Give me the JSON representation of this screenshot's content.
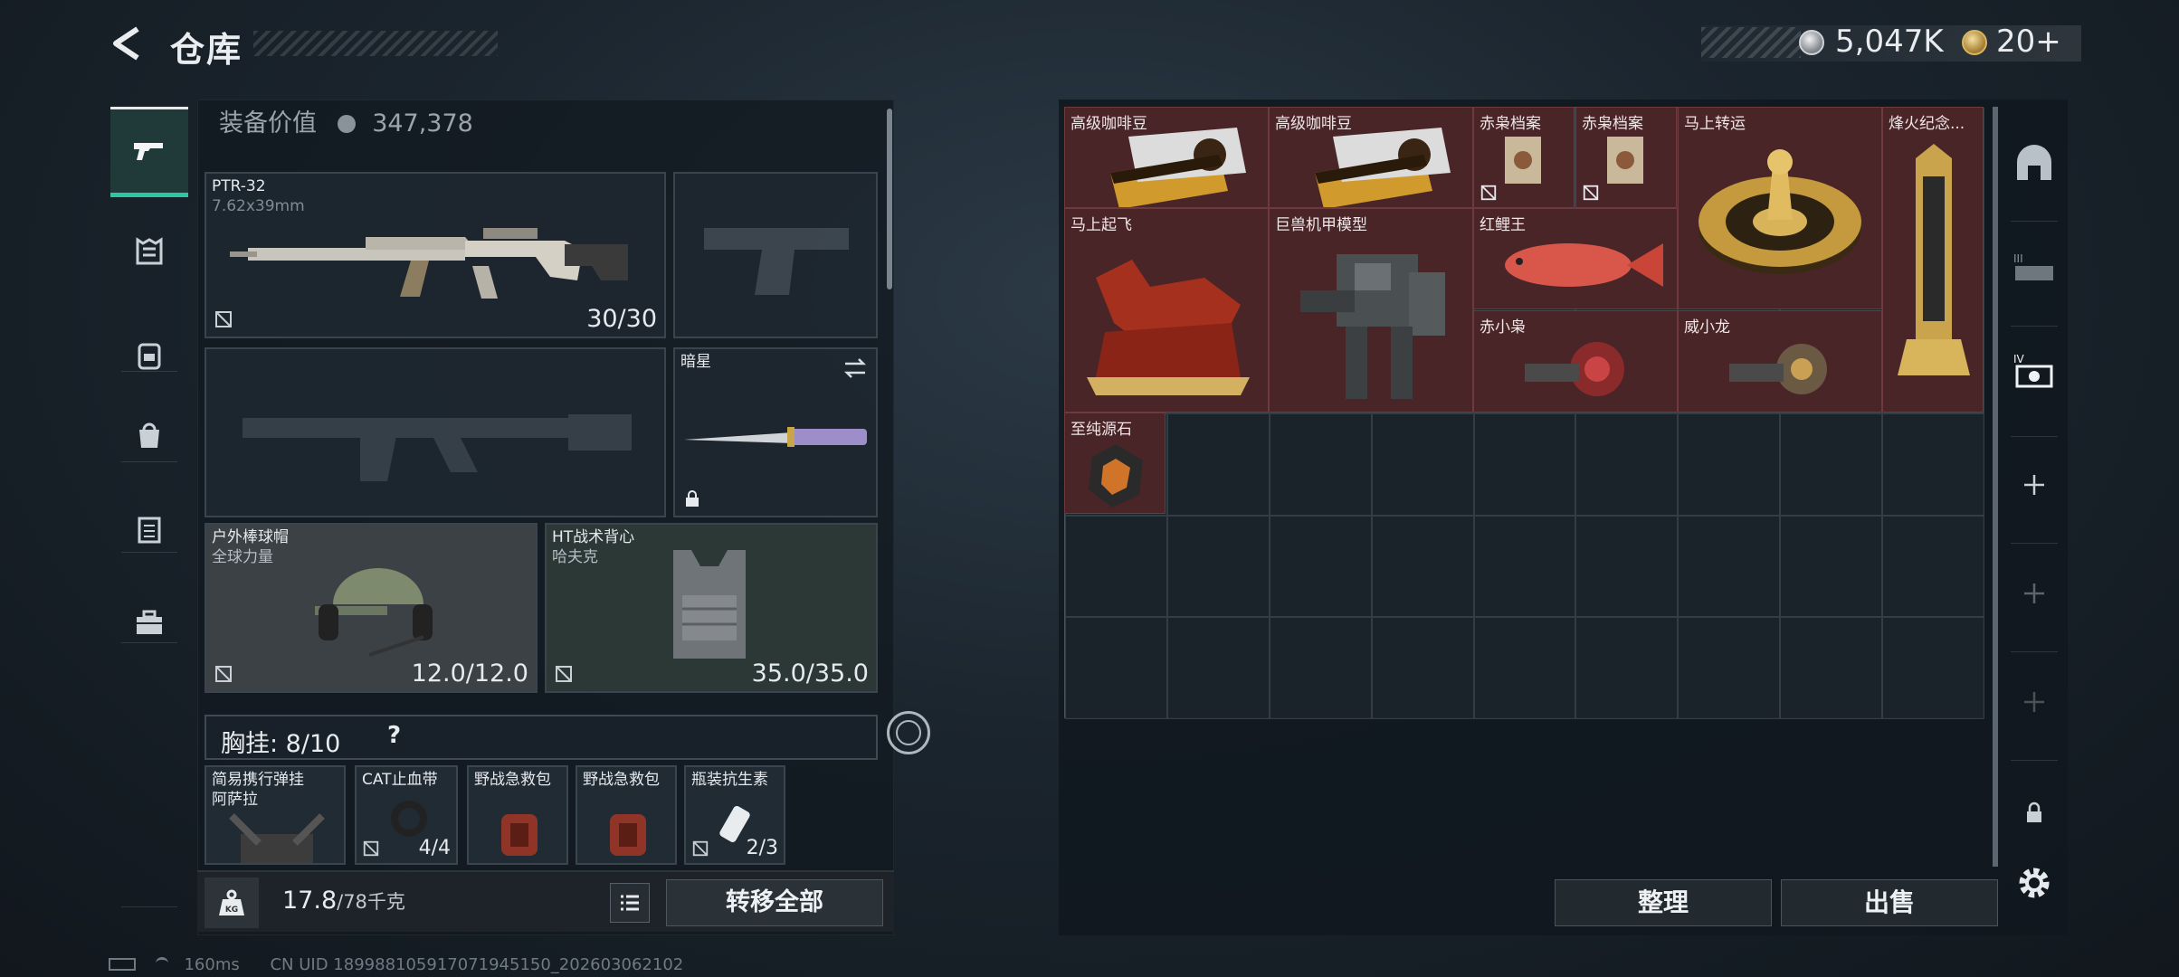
{
  "header": {
    "title": "仓库",
    "silver_amount": "5,047K",
    "gold_amount": "20+"
  },
  "loadout": {
    "equip_value_label": "装备价值",
    "equip_value": "347,378",
    "primary": {
      "name": "PTR-32",
      "caliber": "7.62x39mm",
      "ammo": "30/30"
    },
    "melee": {
      "name": "暗星"
    },
    "helmet": {
      "name": "户外棒球帽",
      "sub": "全球力量",
      "durability": "12.0/12.0"
    },
    "armor": {
      "name": "HT战术背心",
      "sub": "哈夫克",
      "durability": "35.0/35.0"
    },
    "chest_rig_label": "胸挂: 8/10",
    "chest_help": "?",
    "chest_items": [
      {
        "name": "简易携行弹挂",
        "sub": "阿萨拉",
        "count": ""
      },
      {
        "name": "CAT止血带",
        "sub": "",
        "count": "4/4"
      },
      {
        "name": "野战急救包",
        "sub": "",
        "count": ""
      },
      {
        "name": "野战急救包",
        "sub": "",
        "count": ""
      },
      {
        "name": "瓶装抗生素",
        "sub": "",
        "count": "2/3"
      }
    ],
    "weight": "17.8",
    "weight_max": "/78千克",
    "transfer_all": "转移全部"
  },
  "storage": {
    "items": [
      {
        "name": "高级咖啡豆",
        "icon": "coffee-beans-icon"
      },
      {
        "name": "高级咖啡豆",
        "icon": "coffee-beans-icon"
      },
      {
        "name": "赤枭档案",
        "icon": "file-icon"
      },
      {
        "name": "赤枭档案",
        "icon": "file-icon"
      },
      {
        "name": "马上转运",
        "icon": "roulette-icon"
      },
      {
        "name": "烽火纪念...",
        "icon": "trophy-icon"
      },
      {
        "name": "马上起飞",
        "icon": "horse-statue-icon"
      },
      {
        "name": "巨兽机甲模型",
        "icon": "mech-icon"
      },
      {
        "name": "红鲤王",
        "icon": "carp-icon"
      },
      {
        "name": "赤小枭",
        "icon": "figurine-icon"
      },
      {
        "name": "威小龙",
        "icon": "figurine-icon"
      },
      {
        "name": "至纯源石",
        "icon": "gem-icon"
      }
    ],
    "sort_label": "整理",
    "sell_label": "出售"
  },
  "status": {
    "ping": "160ms",
    "uid": "CN UID 189988105917071945150_202603062102"
  },
  "colors": {
    "accent": "#2fc7a2",
    "item_bg": "#4a2528",
    "panel": "#121a21"
  }
}
